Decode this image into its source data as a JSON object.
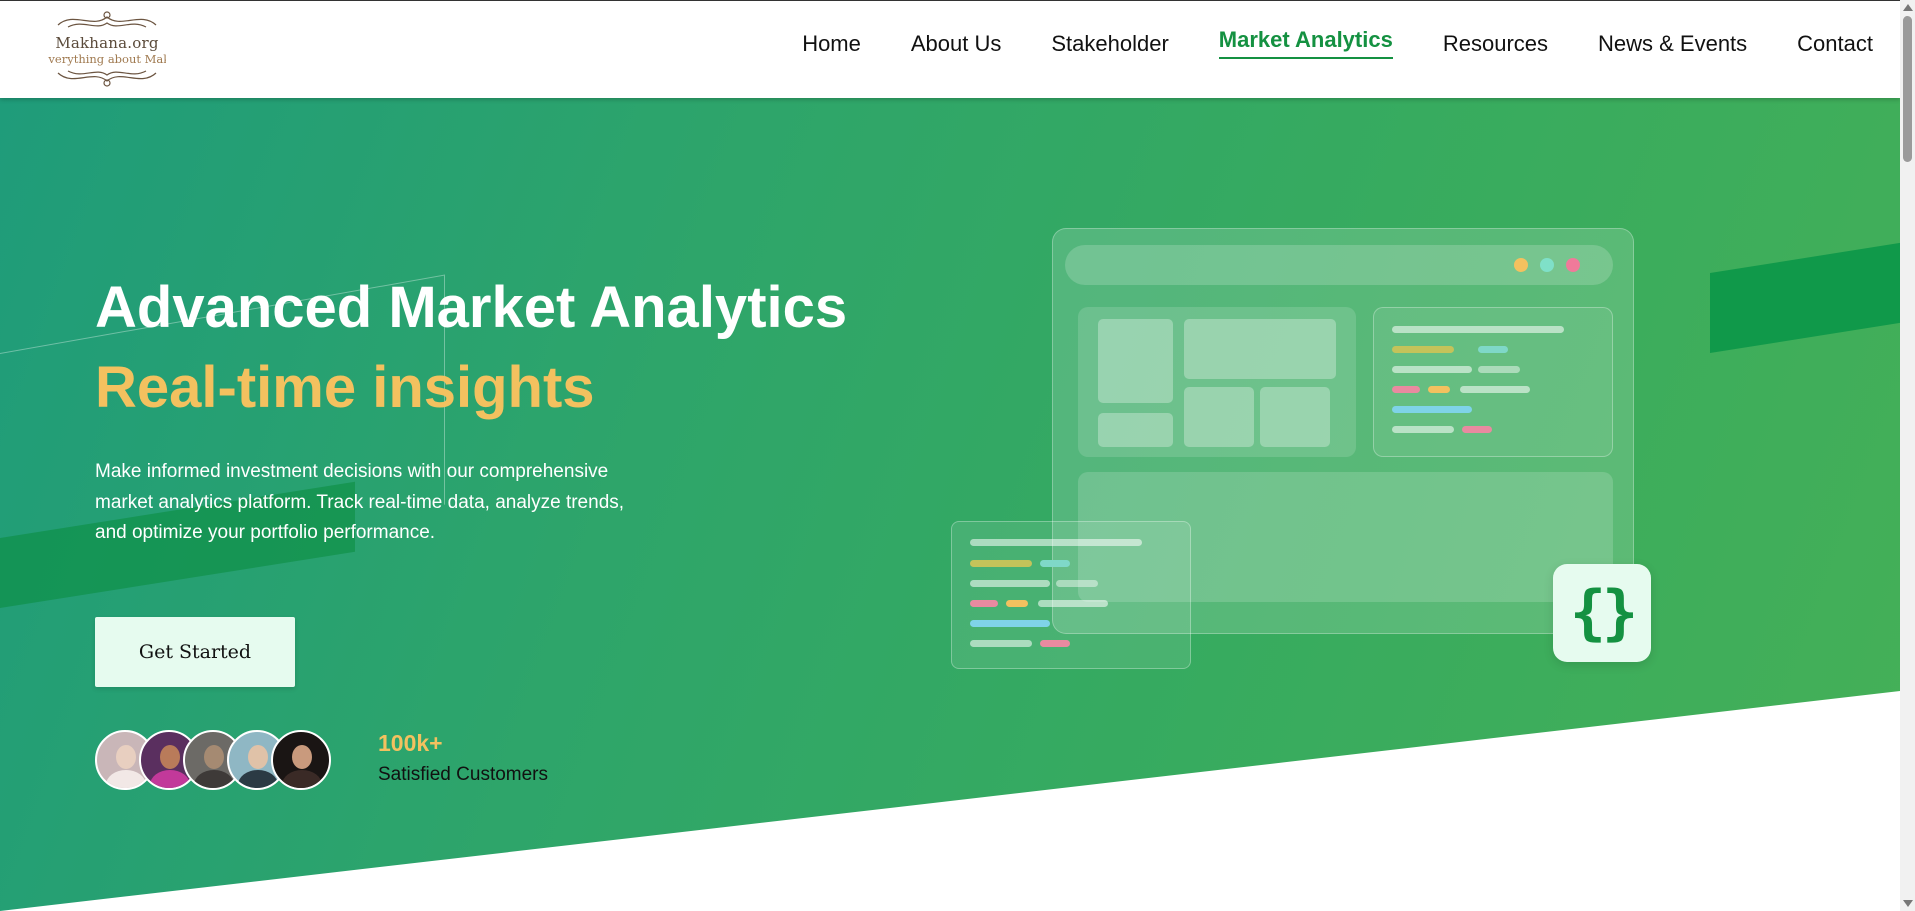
{
  "header": {
    "logo": {
      "title": "Makhana.org",
      "tagline": "Everything about Makhana"
    },
    "nav": [
      {
        "label": "Home",
        "active": false
      },
      {
        "label": "About Us",
        "active": false
      },
      {
        "label": "Stakeholder",
        "active": false
      },
      {
        "label": "Market Analytics",
        "active": true
      },
      {
        "label": "Resources",
        "active": false
      },
      {
        "label": "News & Events",
        "active": false
      },
      {
        "label": "Contact",
        "active": false
      }
    ]
  },
  "hero": {
    "title": "Advanced Market Analytics",
    "subtitle": "Real-time insights",
    "description": "Make informed investment decisions with our comprehensive market analytics platform. Track real-time data, analyze trends, and optimize your portfolio performance.",
    "cta_label": "Get Started",
    "stats": {
      "number": "100k+",
      "label": "Satisfied Customers"
    },
    "illustration": {
      "brace_glyph": "{}"
    }
  },
  "colors": {
    "brand_green": "#149141",
    "accent_yellow": "#f3c15f",
    "hero_gradient_start": "#1f9c7a",
    "hero_gradient_end": "#45b057",
    "cta_background": "#e6fbef"
  },
  "icons": {
    "logo": "ornamental-flourish-icon",
    "code": "curly-braces-icon"
  }
}
